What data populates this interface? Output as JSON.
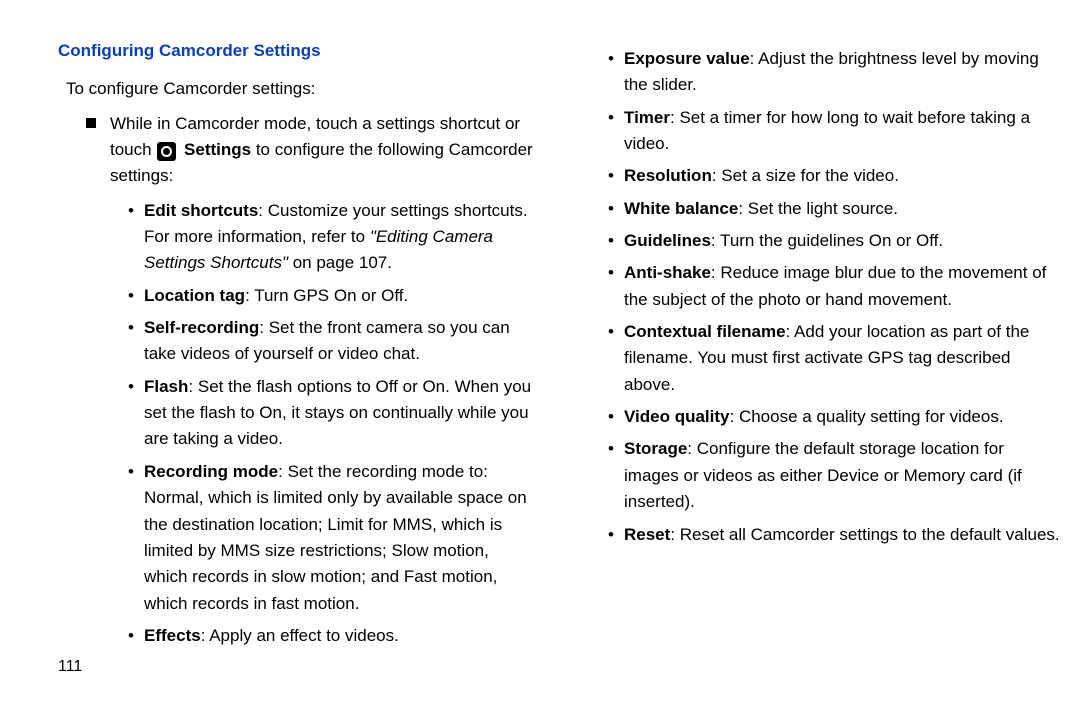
{
  "heading": "Configuring Camcorder Settings",
  "intro": "To configure Camcorder settings:",
  "step": {
    "pre": "While in Camcorder mode, touch a settings shortcut or touch ",
    "icon": "gear-icon",
    "bold": " Settings",
    "post": " to configure the following Camcorder settings:"
  },
  "left_items": {
    "edit_shortcuts": {
      "title": "Edit shortcuts",
      "body1": ": Customize your settings shortcuts. For more information, refer to ",
      "em": "\"Editing Camera Settings Shortcuts\"",
      "body2": " on page 107."
    },
    "location_tag": {
      "title": "Location tag",
      "body": ": Turn GPS On or Off."
    },
    "self_recording": {
      "title": "Self-recording",
      "body": ": Set the front camera so you can take videos of yourself or video chat."
    },
    "flash": {
      "title": "Flash",
      "body": ": Set the flash options to Off or On. When you set the flash to On, it stays on continually while you are taking a video."
    },
    "recording_mode": {
      "title": "Recording mode",
      "body": ": Set the recording mode to: Normal, which is limited only by available space on the destination location; Limit for MMS, which is limited by MMS size restrictions; Slow motion, which records in slow motion; and Fast motion, which records in fast motion."
    },
    "effects": {
      "title": "Effects",
      "body": ": Apply an effect to videos."
    }
  },
  "right_items": {
    "exposure": {
      "title": "Exposure value",
      "body": ": Adjust the brightness level by moving the slider."
    },
    "timer": {
      "title": "Timer",
      "body": ": Set a timer for how long to wait before taking a video."
    },
    "resolution": {
      "title": "Resolution",
      "body": ": Set a size for the video."
    },
    "white_balance": {
      "title": "White balance",
      "body": ": Set the light source."
    },
    "guidelines": {
      "title": "Guidelines",
      "body": ": Turn the guidelines On or Off."
    },
    "anti_shake": {
      "title": "Anti-shake",
      "body": ": Reduce image blur due to the movement of the subject of the photo or hand movement."
    },
    "contextual": {
      "title": "Contextual filename",
      "body": ": Add your location as part of the filename. You must first activate GPS tag described above."
    },
    "video_quality": {
      "title": "Video quality",
      "body": ": Choose a quality setting for videos."
    },
    "storage": {
      "title": "Storage",
      "body": ": Configure the default storage location for images or videos as either Device or Memory card (if inserted)."
    },
    "reset": {
      "title": "Reset",
      "body": ": Reset all Camcorder settings to the default values."
    }
  },
  "page_number": "111"
}
